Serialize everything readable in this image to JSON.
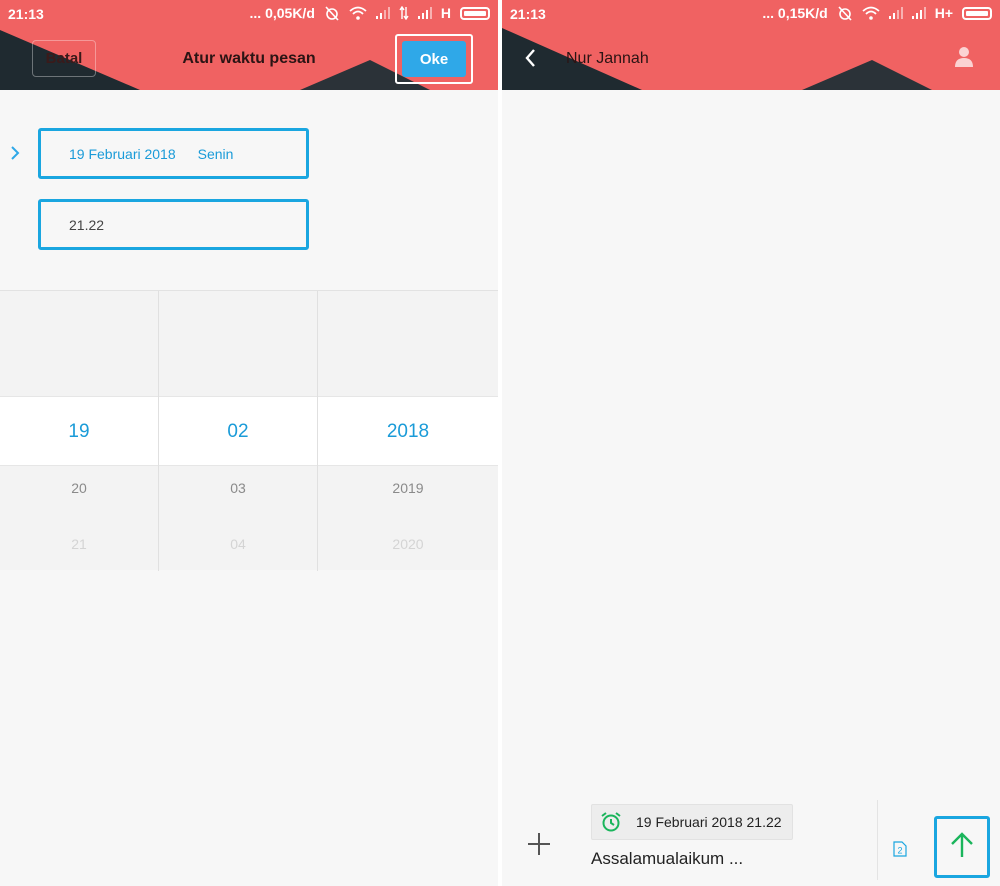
{
  "left_screen": {
    "status_bar": {
      "time": "21:13",
      "network_speed": "... 0,05K/d",
      "network_type": "H"
    },
    "toolbar": {
      "cancel_label": "Batal",
      "title": "Atur waktu pesan",
      "ok_label": "Oke"
    },
    "date_field": {
      "date": "19 Februari 2018",
      "day_of_week": "Senin"
    },
    "time_field": {
      "value": "21.22"
    },
    "picker": {
      "day": {
        "selected": "19",
        "next": "20",
        "next2": "21"
      },
      "month": {
        "selected": "02",
        "next": "03",
        "next2": "04"
      },
      "year": {
        "selected": "2018",
        "next": "2019",
        "next2": "2020"
      }
    }
  },
  "right_screen": {
    "status_bar": {
      "time": "21:13",
      "network_speed": "... 0,15K/d",
      "network_type": "H+"
    },
    "toolbar": {
      "contact_name": "Nur Jannah"
    },
    "composer": {
      "scheduled_time": "19 Februari 2018 21.22",
      "message": "Assalamualaikum ...",
      "sim_slot": "2"
    }
  },
  "colors": {
    "header": "#f06262",
    "accent_blue": "#1aa6e0",
    "send_green": "#1bb55c"
  },
  "icons": [
    "back-chevron-icon",
    "person-icon",
    "plus-icon",
    "alarm-icon",
    "sim-icon",
    "send-arrow-icon",
    "wifi-icon",
    "signal-icon",
    "battery-icon"
  ]
}
